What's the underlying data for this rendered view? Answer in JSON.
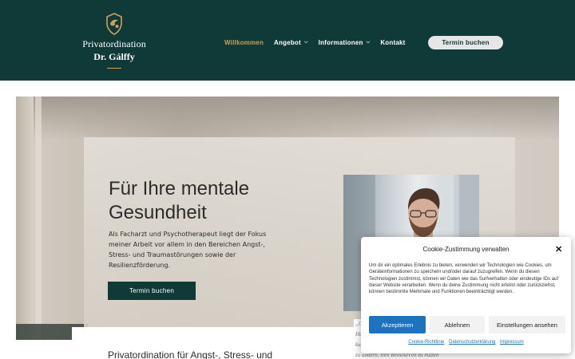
{
  "header": {
    "logo_line1": "Privatordination",
    "logo_line2": "Dr. Gálffy",
    "nav": [
      {
        "label": "Willkommen",
        "active": true,
        "has_dropdown": false
      },
      {
        "label": "Angebot",
        "active": false,
        "has_dropdown": true
      },
      {
        "label": "Informationen",
        "active": false,
        "has_dropdown": true
      },
      {
        "label": "Kontakt",
        "active": false,
        "has_dropdown": false
      }
    ],
    "book_button": "Termin buchen"
  },
  "hero": {
    "title": "Für Ihre mentale Gesundheit",
    "text": "Als Facharzt und Psychotherapeut liegt der Fokus meiner Arbeit vor allem in den Bereichen Angst-, Stress- und Traumastörungen sowie der Resilienzförderung.",
    "button": "Termin buchen"
  },
  "section": {
    "title": "Privatordination für Angst-, Stress- und",
    "quote_lines": [
      "„G",
      "He",
      "ku",
      "zu ändern, Ihre Ressourcen zu nutzen"
    ]
  },
  "cookie": {
    "title": "Cookie-Zustimmung verwalten",
    "body": "Um dir ein optimales Erlebnis zu bieten, verwenden wir Technologien wie Cookies, um Geräteinformationen zu speichern und/oder darauf zuzugreifen. Wenn du diesen Technologien zustimmst, können wir Daten wie das Surfverhalten oder eindeutige IDs auf dieser Website verarbeiten. Wenn du deine Zustimmung nicht erteilst oder zurückziehst, können bestimmte Merkmale und Funktionen beeinträchtigt werden.",
    "accept": "Akzeptieren",
    "decline": "Ablehnen",
    "settings": "Einstellungen ansehen",
    "links": [
      "Cookie-Richtlinie",
      "Datenschutzerklärung",
      "Impressum"
    ]
  },
  "colors": {
    "brand_dark": "#0f3a37",
    "accent_gold": "#c9a35a",
    "cookie_blue": "#1e73be"
  },
  "icons": {
    "logo": "crest-logo-icon",
    "close": "close-icon",
    "dropdown": "chevron-down-icon"
  }
}
